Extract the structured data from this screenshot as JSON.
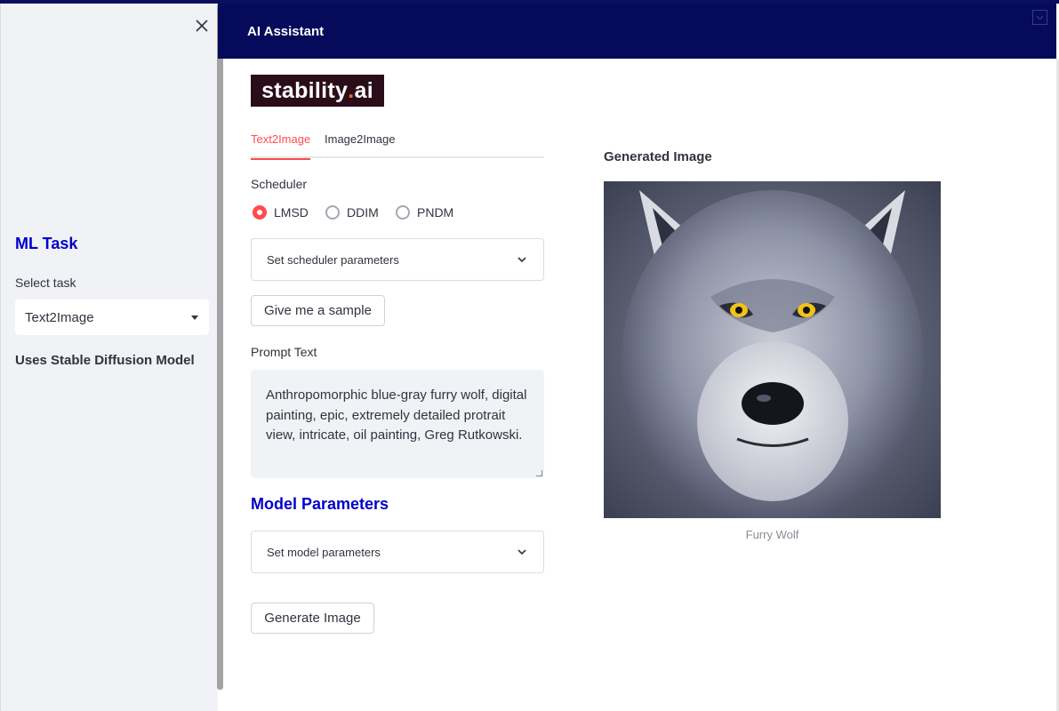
{
  "header": {
    "title": "AI Assistant"
  },
  "sidebar": {
    "section_title": "ML Task",
    "select_label": "Select task",
    "select_value": "Text2Image",
    "model_note": "Uses Stable Diffusion Model"
  },
  "logo": {
    "text_main": "stability",
    "text_dot": ".",
    "text_suffix": "ai"
  },
  "tabs": [
    {
      "label": "Text2Image",
      "active": true
    },
    {
      "label": "Image2Image",
      "active": false
    }
  ],
  "scheduler": {
    "label": "Scheduler",
    "options": [
      {
        "label": "LMSD",
        "selected": true
      },
      {
        "label": "DDIM",
        "selected": false
      },
      {
        "label": "PNDM",
        "selected": false
      }
    ],
    "expander_label": "Set scheduler parameters"
  },
  "sample_button": "Give me a sample",
  "prompt": {
    "label": "Prompt Text",
    "value": "Anthropomorphic blue-gray furry wolf, digital painting, epic, extremely detailed protrait view, intricate, oil painting, Greg Rutkowski."
  },
  "model": {
    "title": "Model Parameters",
    "expander_label": "Set model parameters"
  },
  "generate_button": "Generate Image",
  "output": {
    "label": "Generated Image",
    "caption": "Furry Wolf"
  },
  "colors": {
    "header_bg": "#050a5a",
    "accent": "#ff4b4b",
    "heading_blue": "#0000cc",
    "sidebar_bg": "#f0f2f6"
  }
}
